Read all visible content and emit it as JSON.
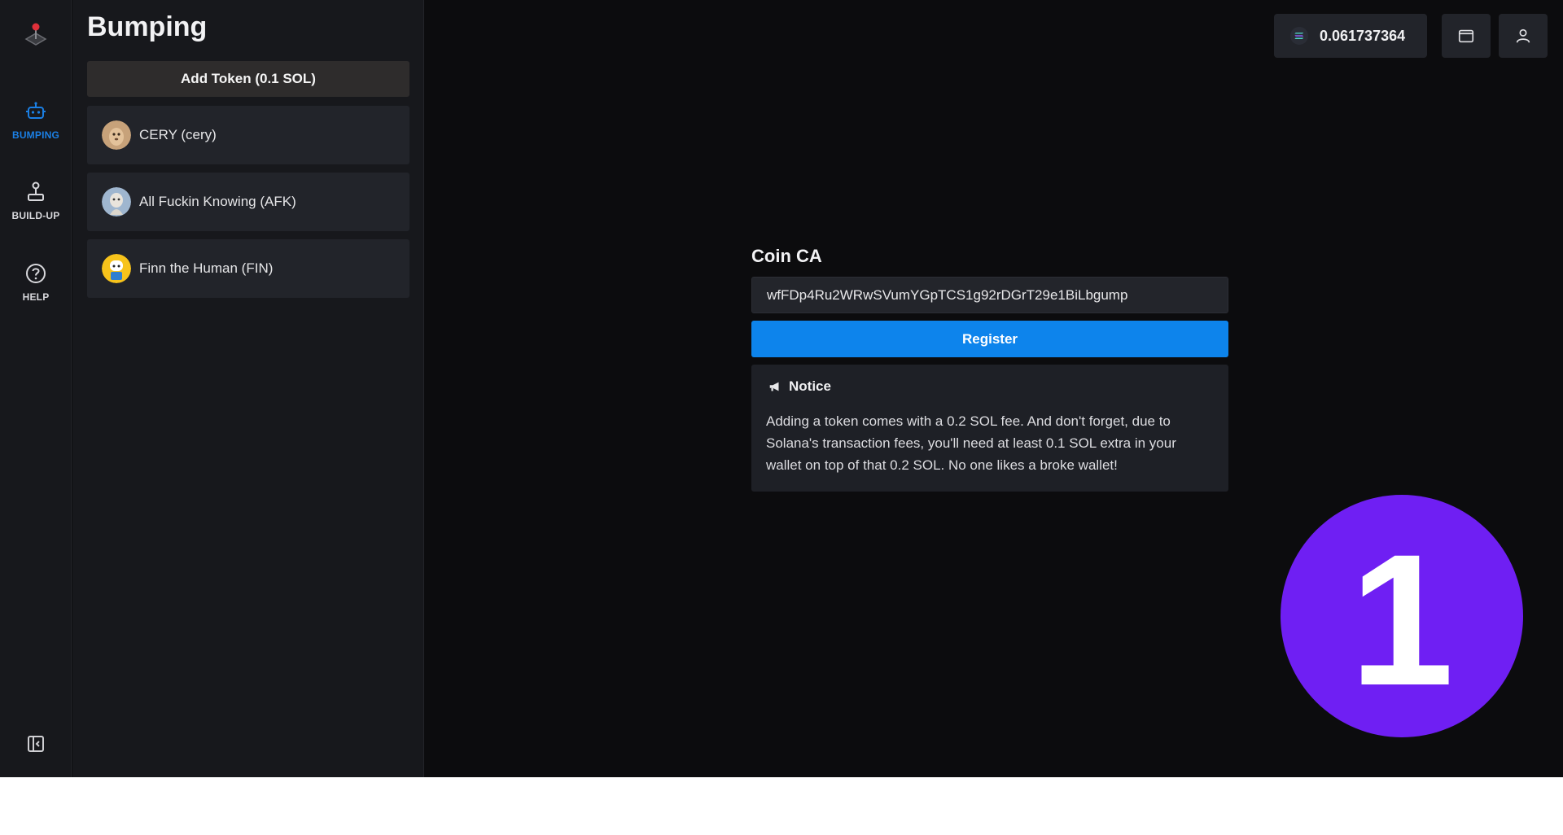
{
  "nav": {
    "items": [
      {
        "label": "BUMPING",
        "icon": "robot-icon",
        "active": true
      },
      {
        "label": "BUILD-UP",
        "icon": "joystick-icon",
        "active": false
      },
      {
        "label": "HELP",
        "icon": "help-circle-icon",
        "active": false
      }
    ]
  },
  "panel": {
    "title": "Bumping",
    "add_token_label": "Add Token (0.1 SOL)",
    "tokens": [
      {
        "name": "CERY (cery)"
      },
      {
        "name": "All Fuckin Knowing (AFK)"
      },
      {
        "name": "Finn the Human (FIN)"
      }
    ]
  },
  "header": {
    "balance": "0.061737364"
  },
  "form": {
    "label": "Coin CA",
    "value": "wfFDp4Ru2WRwSVumYGpTCS1g92rDGrT29e1BiLbgump",
    "register_label": "Register"
  },
  "notice": {
    "title": "Notice",
    "body": "Adding a token comes with a 0.2 SOL fee. And don't forget, due to Solana's transaction fees, you'll need at least 0.1 SOL extra in your wallet on top of that 0.2 SOL. No one likes a broke wallet!"
  },
  "badge": {
    "number": "1"
  },
  "colors": {
    "accent": "#0d84ec",
    "active_nav": "#1b7fe4",
    "badge": "#6f1ff3"
  }
}
